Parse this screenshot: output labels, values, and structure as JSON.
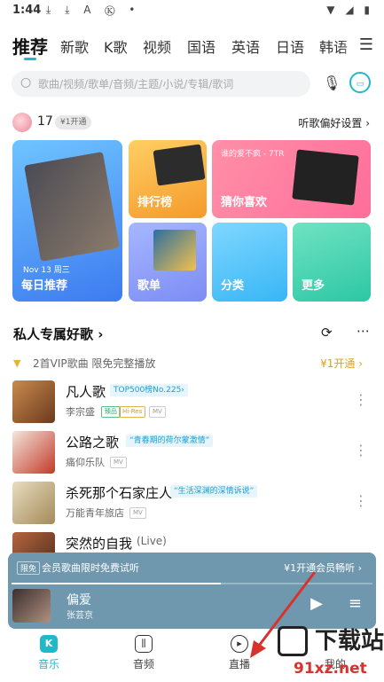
{
  "status_bar": {
    "time": "1:44",
    "left_icons": "⤓ ⤓ A Ⓚ •",
    "right_icons": "▼ ◢ ▮"
  },
  "tabs": [
    "推荐",
    "新歌",
    "K歌",
    "视频",
    "国语",
    "英语",
    "日语",
    "韩语"
  ],
  "active_tab": "推荐",
  "search": {
    "placeholder": "歌曲/视频/歌单/音频/主题/小说/专辑/歌词"
  },
  "user": {
    "level": "17",
    "vip_badge": "¥1开通",
    "prefs_link": "听歌偏好设置 ›"
  },
  "cards": {
    "daily": {
      "date": "Nov 13 周三",
      "label": "每日推荐"
    },
    "rank": {
      "label": "排行榜"
    },
    "guess": {
      "subtitle": "谁的爱不疯 - 7TR",
      "label": "猜你喜欢"
    },
    "songlist": {
      "label": "歌单"
    },
    "category": {
      "label": "分类"
    },
    "more": {
      "label": "更多"
    }
  },
  "section": {
    "title": "私人专属好歌 ›",
    "vip_text": "2首VIP歌曲 限免完整播放",
    "vip_button": "¥1开通 ›"
  },
  "songs": [
    {
      "title": "凡人歌",
      "tag": "TOP500榜No.225›",
      "tag_color": "#1a9fd6",
      "tag_bg": "#e6f5fc",
      "artist": "李宗盛",
      "badges": [
        "臻品",
        "Hi-Res",
        "MV"
      ]
    },
    {
      "title": "公路之歌",
      "tag": "“青春期的荷尔蒙激情”",
      "tag_color": "#1a9fd6",
      "tag_bg": "#e6f5fc",
      "artist": "痛仰乐队",
      "badges": [
        "MV"
      ]
    },
    {
      "title": "杀死那个石家庄人",
      "tag": "“生活深渊的深情诉说”",
      "tag_color": "#1a9fd6",
      "tag_bg": "#e6f5fc",
      "artist": "万能青年旅店",
      "badges": [
        "MV"
      ]
    },
    {
      "title": "突然的自我",
      "tag": "(Live)",
      "tag_color": "#666",
      "tag_bg": "transparent",
      "artist": "",
      "badges": []
    }
  ],
  "player": {
    "promo_tag": "限免",
    "promo_text": "会员歌曲限时免费试听",
    "promo_right": "¥1开通会员畅听 ›",
    "title": "偏爱",
    "artist": "张芸京",
    "progress": 0.58
  },
  "nav": [
    {
      "label": "音乐",
      "icon": "K"
    },
    {
      "label": "音频",
      "icon": "▯"
    },
    {
      "label": "直播",
      "icon": "●"
    },
    {
      "label": "我的",
      "icon": ""
    }
  ],
  "watermark": {
    "text": "下载站",
    "url": "91xz.net"
  },
  "colors": {
    "accent": "#1fb9c8",
    "player_bg": "#6f98ae",
    "vip_gold": "#d9a21b",
    "arrow": "#d8322c"
  }
}
